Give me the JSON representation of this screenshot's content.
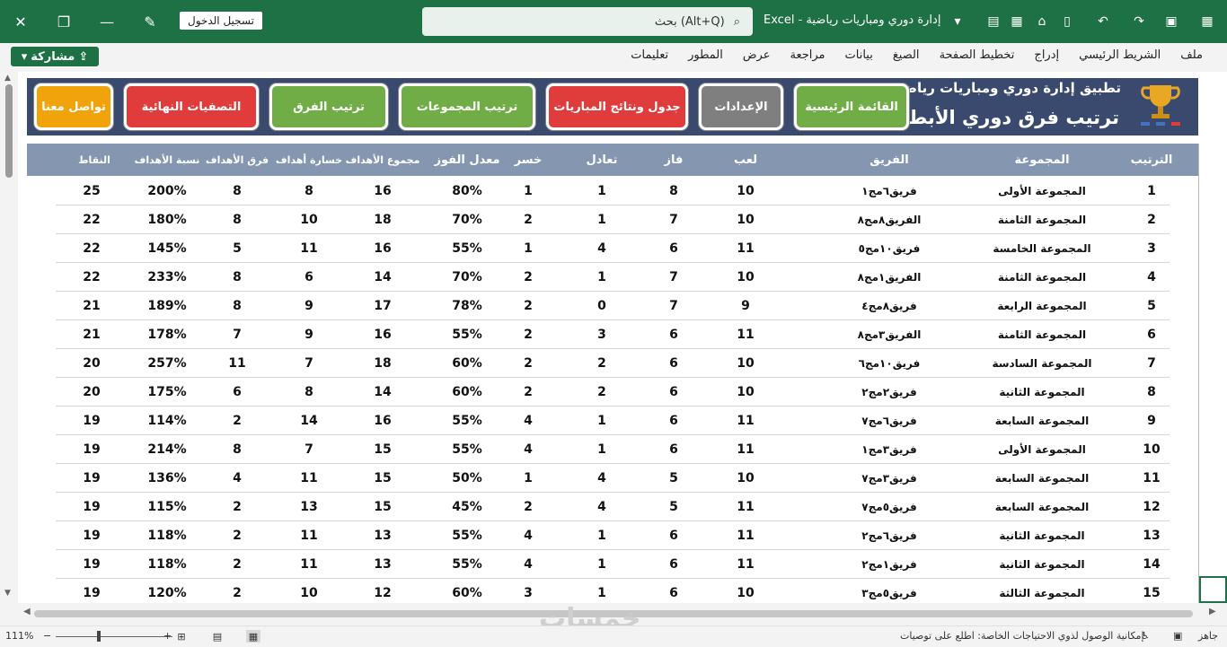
{
  "window": {
    "title": "إدارة دوري ومباريات رياضية",
    "app": "Excel",
    "signin_label": "تسجيل الدخول",
    "search_placeholder": "بحث (Alt+Q)"
  },
  "menu": {
    "share_label": "مشاركة",
    "items": [
      "ملف",
      "الشريط الرئيسي",
      "إدراج",
      "تخطيط الصفحة",
      "الصيغ",
      "بيانات",
      "مراجعة",
      "عرض",
      "المطور",
      "تعليمات"
    ]
  },
  "banner": {
    "title": "تطبيق إدارة دوري ومباريات رياضية",
    "subtitle": "ترتيب فرق دوري الأبطال"
  },
  "nav_buttons": [
    {
      "label": "القائمة الرئيسية",
      "color": "#70ad47"
    },
    {
      "label": "الإعدادات",
      "color": "#7f7f7f"
    },
    {
      "label": "جدول ونتائج المباريات",
      "color": "#e03c3c"
    },
    {
      "label": "ترتيب المجموعات",
      "color": "#70ad47"
    },
    {
      "label": "ترتيب الفرق",
      "color": "#70ad47"
    },
    {
      "label": "التصفيات النهائية",
      "color": "#e03c3c"
    },
    {
      "label": "تواصل معنا",
      "color": "#f0a30a"
    }
  ],
  "table": {
    "headers": [
      "الترتيب",
      "المجموعة",
      "الفريق",
      "لعب",
      "فاز",
      "تعادل",
      "خسر",
      "معدل الفوز",
      "مجموع الأهداف",
      "خسارة أهداف",
      "فرق الأهداف",
      "نسبة الأهداف",
      "النقاط"
    ],
    "rows": [
      [
        "1",
        "المجموعة الأولى",
        "فريق٦مج١",
        "10",
        "8",
        "1",
        "1",
        "80%",
        "16",
        "8",
        "8",
        "200%",
        "25"
      ],
      [
        "2",
        "المجموعة الثامنة",
        "الفريق٨مج٨",
        "10",
        "7",
        "1",
        "2",
        "70%",
        "18",
        "10",
        "8",
        "180%",
        "22"
      ],
      [
        "3",
        "المجموعة الخامسة",
        "فريق١٠مج٥",
        "11",
        "6",
        "4",
        "1",
        "55%",
        "16",
        "11",
        "5",
        "145%",
        "22"
      ],
      [
        "4",
        "المجموعة الثامنة",
        "الفريق١مج٨",
        "10",
        "7",
        "1",
        "2",
        "70%",
        "14",
        "6",
        "8",
        "233%",
        "22"
      ],
      [
        "5",
        "المجموعة الرابعة",
        "فريق٨مج٤",
        "9",
        "7",
        "0",
        "2",
        "78%",
        "17",
        "9",
        "8",
        "189%",
        "21"
      ],
      [
        "6",
        "المجموعة الثامنة",
        "الفريق٣مج٨",
        "11",
        "6",
        "3",
        "2",
        "55%",
        "16",
        "9",
        "7",
        "178%",
        "21"
      ],
      [
        "7",
        "المجموعة السادسة",
        "فريق١٠مج٦",
        "10",
        "6",
        "2",
        "2",
        "60%",
        "18",
        "7",
        "11",
        "257%",
        "20"
      ],
      [
        "8",
        "المجموعة الثانية",
        "فريق٢مج٢",
        "10",
        "6",
        "2",
        "2",
        "60%",
        "14",
        "8",
        "6",
        "175%",
        "20"
      ],
      [
        "9",
        "المجموعة السابعة",
        "فريق٦مج٧",
        "11",
        "6",
        "1",
        "4",
        "55%",
        "16",
        "14",
        "2",
        "114%",
        "19"
      ],
      [
        "10",
        "المجموعة الأولى",
        "فريق٣مج١",
        "11",
        "6",
        "1",
        "4",
        "55%",
        "15",
        "7",
        "8",
        "214%",
        "19"
      ],
      [
        "11",
        "المجموعة السابعة",
        "فريق٣مج٧",
        "10",
        "5",
        "4",
        "1",
        "50%",
        "15",
        "11",
        "4",
        "136%",
        "19"
      ],
      [
        "12",
        "المجموعة السابعة",
        "فريق٥مج٧",
        "11",
        "5",
        "4",
        "2",
        "45%",
        "15",
        "13",
        "2",
        "115%",
        "19"
      ],
      [
        "13",
        "المجموعة الثانية",
        "فريق٦مج٢",
        "11",
        "6",
        "1",
        "4",
        "55%",
        "13",
        "11",
        "2",
        "118%",
        "19"
      ],
      [
        "14",
        "المجموعة الثانية",
        "فريق١مج٢",
        "11",
        "6",
        "1",
        "4",
        "55%",
        "13",
        "11",
        "2",
        "118%",
        "19"
      ],
      [
        "15",
        "المجموعة الثالثة",
        "فريق٥مج٣",
        "10",
        "6",
        "1",
        "3",
        "60%",
        "12",
        "10",
        "2",
        "120%",
        "19"
      ]
    ]
  },
  "status": {
    "ready": "جاهز",
    "accessibility": "إمكانية الوصول لذوي الاحتياجات الخاصة: اطلع على توصيات",
    "zoom": "111%"
  },
  "watermark": "خمسات",
  "colors": {
    "titlebar": "#1e7145",
    "banner": "#3a4a6e",
    "header": "#8496b0"
  }
}
